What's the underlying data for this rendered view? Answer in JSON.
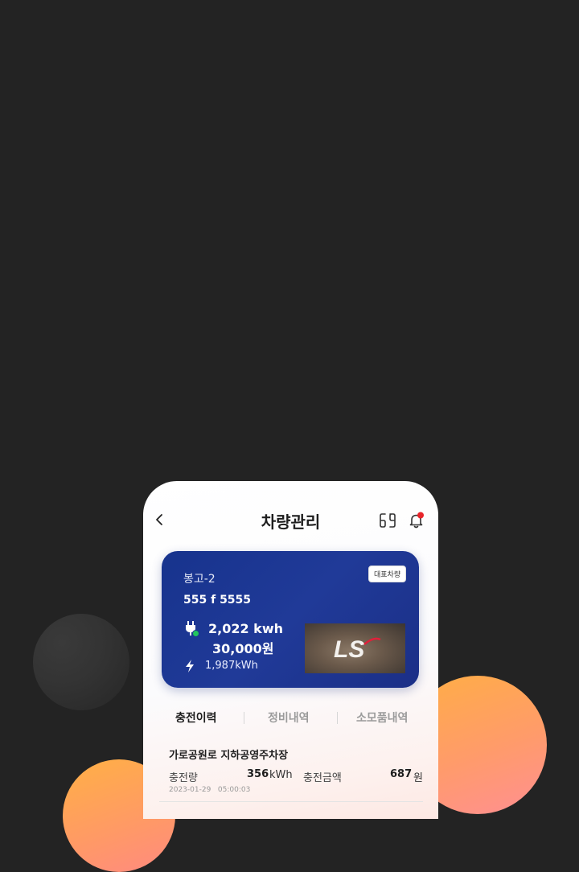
{
  "header": {
    "title": "차량관리",
    "back_icon": "back-chevron-icon",
    "support_icon": "customer-support-icon",
    "notification_icon": "bell-icon",
    "notification_dot_color": "#e8242a"
  },
  "vehicle_card": {
    "name": "봉고-2",
    "plate": "555 f 5555",
    "badge": "대표차량",
    "energy": "2,022 kwh",
    "amount": "30,000원",
    "charged": "1,987kWh",
    "status_color": "#22c55e",
    "background_color": "#1b348f",
    "image_logo": "LS"
  },
  "tabs": [
    {
      "label": "충전이력",
      "active": true
    },
    {
      "label": "정비내역",
      "active": false
    },
    {
      "label": "소모품내역",
      "active": false
    }
  ],
  "history": [
    {
      "station": "가로공원로 지하공영주차장",
      "charge_label": "충전량",
      "charge_value": "356",
      "charge_unit": "kWh",
      "amount_label": "충전금액",
      "amount_value": "687",
      "amount_unit": "원",
      "date": "2023-01-29",
      "time": "05:00:03"
    }
  ]
}
